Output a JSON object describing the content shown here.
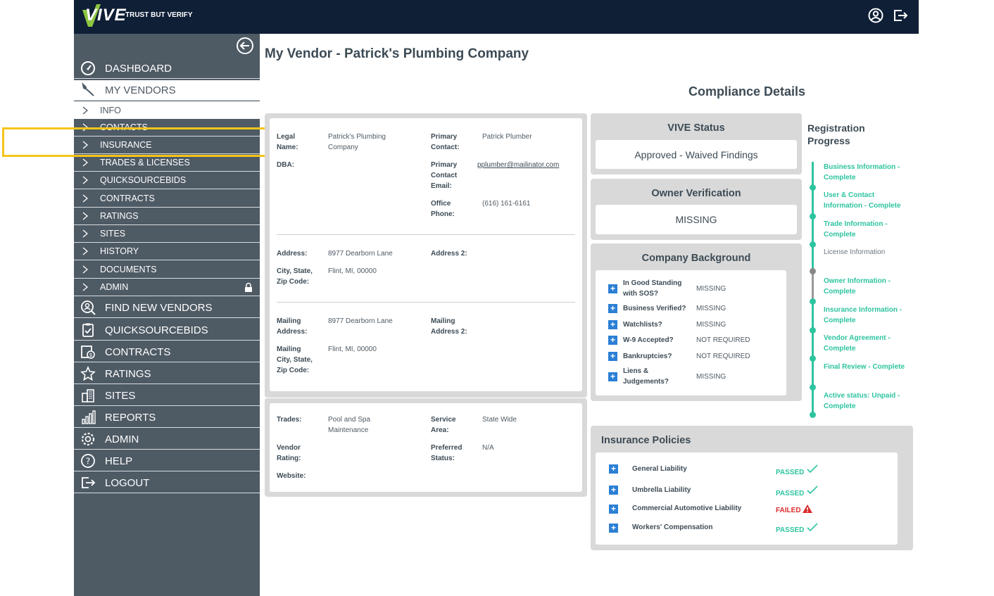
{
  "header": {
    "logo_text": "VIVE",
    "tagline": "TRUST BUT VERIFY",
    "profile_icon": "user-circle-icon",
    "logout_icon": "logout-icon"
  },
  "sidebar": {
    "main_top": [
      {
        "label": "DASHBOARD",
        "icon": "gauge-icon"
      },
      {
        "label": "MY VENDORS",
        "icon": "wrench-icon"
      }
    ],
    "sub_items": [
      "INFO",
      "CONTACTS",
      "INSURANCE",
      "TRADES & LICENSES",
      "QUICKSOURCEBIDS",
      "CONTRACTS",
      "RATINGS",
      "SITES",
      "HISTORY",
      "DOCUMENTS",
      "ADMIN"
    ],
    "main_bottom": [
      {
        "label": "FIND NEW VENDORS",
        "icon": "search-user-icon"
      },
      {
        "label": "QUICKSOURCEBIDS",
        "icon": "clipboard-icon"
      },
      {
        "label": "CONTRACTS",
        "icon": "contract-icon"
      },
      {
        "label": "RATINGS",
        "icon": "star-icon"
      },
      {
        "label": "SITES",
        "icon": "building-icon"
      },
      {
        "label": "REPORTS",
        "icon": "bar-chart-icon"
      },
      {
        "label": "ADMIN",
        "icon": "gear-icon"
      },
      {
        "label": "HELP",
        "icon": "help-icon"
      },
      {
        "label": "LOGOUT",
        "icon": "logout-icon"
      }
    ]
  },
  "page": {
    "title": "My Vendor - Patrick's Plumbing Company",
    "compliance_title": "Compliance Details"
  },
  "vendor": {
    "legal_name_label": "Legal Name:",
    "legal_name": "Patrick's Plumbing Company",
    "dba_label": "DBA:",
    "primary_contact_label": "Primary Contact:",
    "primary_contact": "Patrick Plumber",
    "primary_email_label": "Primary Contact Email:",
    "primary_email": "pplumber@mailinator.com",
    "office_phone_label": "Office Phone:",
    "office_phone": "(616) 161-6161",
    "address_label": "Address:",
    "address": "8977 Dearborn Lane",
    "address2_label": "Address 2:",
    "city_label": "City, State, Zip Code:",
    "city": "Flint, MI, 00000",
    "mailing_address_label": "Mailing Address:",
    "mailing_address": "8977 Dearborn Lane",
    "mailing_address2_label": "Mailing Address 2:",
    "mailing_city_label": "Mailing City, State, Zip Code:",
    "mailing_city": "Flint, MI, 00000",
    "trades_label": "Trades:",
    "trades": "Pool and Spa Maintenance",
    "service_area_label": "Service Area:",
    "service_area": "State Wide",
    "vendor_rating_label": "Vendor Rating:",
    "preferred_status_label": "Preferred Status:",
    "preferred_status": "N/A",
    "website_label": "Website:"
  },
  "vive_status": {
    "title": "VIVE Status",
    "value": "Approved - Waived Findings"
  },
  "owner_verification": {
    "title": "Owner Verification",
    "value": "MISSING"
  },
  "company_background": {
    "title": "Company Background",
    "rows": [
      {
        "label": "In Good Standing with SOS?",
        "value": "MISSING"
      },
      {
        "label": "Business Verified?",
        "value": "MISSING"
      },
      {
        "label": "Watchlists?",
        "value": "MISSING"
      },
      {
        "label": "W-9 Accepted?",
        "value": "NOT REQUIRED"
      },
      {
        "label": "Bankruptcies?",
        "value": "NOT REQUIRED"
      },
      {
        "label": "Liens & Judgements?",
        "value": "MISSING"
      }
    ]
  },
  "registration": {
    "title": "Registration Progress",
    "steps": [
      {
        "label": "Business Information - Complete",
        "done": true
      },
      {
        "label": "User & Contact Information - Complete",
        "done": true
      },
      {
        "label": "Trade Information - Complete",
        "done": true
      },
      {
        "label": "License Information",
        "done": false
      },
      {
        "label": "Owner Information - Complete",
        "done": true
      },
      {
        "label": "Insurance Information - Complete",
        "done": true
      },
      {
        "label": "Vendor Agreement - Complete",
        "done": true
      },
      {
        "label": "Final Review - Complete",
        "done": true
      },
      {
        "label": "Active status: Unpaid - Complete",
        "done": true
      }
    ]
  },
  "insurance": {
    "title": "Insurance Policies",
    "policies": [
      {
        "label": "General Liability",
        "status": "PASSED"
      },
      {
        "label": "Umbrella Liability",
        "status": "PASSED"
      },
      {
        "label": "Commercial Automotive Liability",
        "status": "FAILED"
      },
      {
        "label": "Workers' Compensation",
        "status": "PASSED"
      }
    ]
  },
  "colors": {
    "topbar": "#0f1f36",
    "sidebar": "#4e5a64",
    "accent_green": "#2ec4a0",
    "plus_blue": "#2b7fd4",
    "fail_red": "#d92b2b",
    "highlight": "#f5c518"
  }
}
